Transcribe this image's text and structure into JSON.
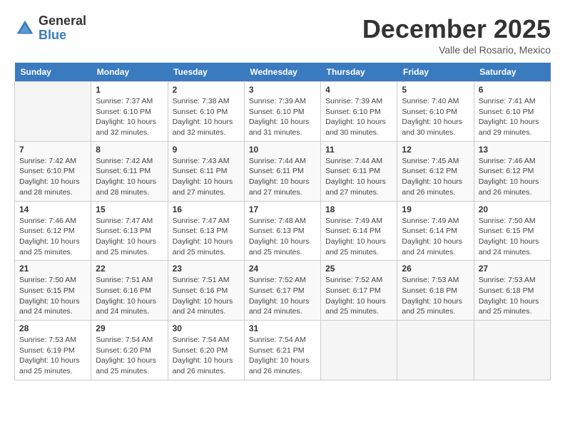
{
  "logo": {
    "general": "General",
    "blue": "Blue"
  },
  "title": "December 2025",
  "location": "Valle del Rosario, Mexico",
  "days_of_week": [
    "Sunday",
    "Monday",
    "Tuesday",
    "Wednesday",
    "Thursday",
    "Friday",
    "Saturday"
  ],
  "weeks": [
    [
      {
        "day": "",
        "info": ""
      },
      {
        "day": "1",
        "info": "Sunrise: 7:37 AM\nSunset: 6:10 PM\nDaylight: 10 hours\nand 32 minutes."
      },
      {
        "day": "2",
        "info": "Sunrise: 7:38 AM\nSunset: 6:10 PM\nDaylight: 10 hours\nand 32 minutes."
      },
      {
        "day": "3",
        "info": "Sunrise: 7:39 AM\nSunset: 6:10 PM\nDaylight: 10 hours\nand 31 minutes."
      },
      {
        "day": "4",
        "info": "Sunrise: 7:39 AM\nSunset: 6:10 PM\nDaylight: 10 hours\nand 30 minutes."
      },
      {
        "day": "5",
        "info": "Sunrise: 7:40 AM\nSunset: 6:10 PM\nDaylight: 10 hours\nand 30 minutes."
      },
      {
        "day": "6",
        "info": "Sunrise: 7:41 AM\nSunset: 6:10 PM\nDaylight: 10 hours\nand 29 minutes."
      }
    ],
    [
      {
        "day": "7",
        "info": "Sunrise: 7:42 AM\nSunset: 6:10 PM\nDaylight: 10 hours\nand 28 minutes."
      },
      {
        "day": "8",
        "info": "Sunrise: 7:42 AM\nSunset: 6:11 PM\nDaylight: 10 hours\nand 28 minutes."
      },
      {
        "day": "9",
        "info": "Sunrise: 7:43 AM\nSunset: 6:11 PM\nDaylight: 10 hours\nand 27 minutes."
      },
      {
        "day": "10",
        "info": "Sunrise: 7:44 AM\nSunset: 6:11 PM\nDaylight: 10 hours\nand 27 minutes."
      },
      {
        "day": "11",
        "info": "Sunrise: 7:44 AM\nSunset: 6:11 PM\nDaylight: 10 hours\nand 27 minutes."
      },
      {
        "day": "12",
        "info": "Sunrise: 7:45 AM\nSunset: 6:12 PM\nDaylight: 10 hours\nand 26 minutes."
      },
      {
        "day": "13",
        "info": "Sunrise: 7:46 AM\nSunset: 6:12 PM\nDaylight: 10 hours\nand 26 minutes."
      }
    ],
    [
      {
        "day": "14",
        "info": "Sunrise: 7:46 AM\nSunset: 6:12 PM\nDaylight: 10 hours\nand 25 minutes."
      },
      {
        "day": "15",
        "info": "Sunrise: 7:47 AM\nSunset: 6:13 PM\nDaylight: 10 hours\nand 25 minutes."
      },
      {
        "day": "16",
        "info": "Sunrise: 7:47 AM\nSunset: 6:13 PM\nDaylight: 10 hours\nand 25 minutes."
      },
      {
        "day": "17",
        "info": "Sunrise: 7:48 AM\nSunset: 6:13 PM\nDaylight: 10 hours\nand 25 minutes."
      },
      {
        "day": "18",
        "info": "Sunrise: 7:49 AM\nSunset: 6:14 PM\nDaylight: 10 hours\nand 25 minutes."
      },
      {
        "day": "19",
        "info": "Sunrise: 7:49 AM\nSunset: 6:14 PM\nDaylight: 10 hours\nand 24 minutes."
      },
      {
        "day": "20",
        "info": "Sunrise: 7:50 AM\nSunset: 6:15 PM\nDaylight: 10 hours\nand 24 minutes."
      }
    ],
    [
      {
        "day": "21",
        "info": "Sunrise: 7:50 AM\nSunset: 6:15 PM\nDaylight: 10 hours\nand 24 minutes."
      },
      {
        "day": "22",
        "info": "Sunrise: 7:51 AM\nSunset: 6:16 PM\nDaylight: 10 hours\nand 24 minutes."
      },
      {
        "day": "23",
        "info": "Sunrise: 7:51 AM\nSunset: 6:16 PM\nDaylight: 10 hours\nand 24 minutes."
      },
      {
        "day": "24",
        "info": "Sunrise: 7:52 AM\nSunset: 6:17 PM\nDaylight: 10 hours\nand 24 minutes."
      },
      {
        "day": "25",
        "info": "Sunrise: 7:52 AM\nSunset: 6:17 PM\nDaylight: 10 hours\nand 25 minutes."
      },
      {
        "day": "26",
        "info": "Sunrise: 7:53 AM\nSunset: 6:18 PM\nDaylight: 10 hours\nand 25 minutes."
      },
      {
        "day": "27",
        "info": "Sunrise: 7:53 AM\nSunset: 6:18 PM\nDaylight: 10 hours\nand 25 minutes."
      }
    ],
    [
      {
        "day": "28",
        "info": "Sunrise: 7:53 AM\nSunset: 6:19 PM\nDaylight: 10 hours\nand 25 minutes."
      },
      {
        "day": "29",
        "info": "Sunrise: 7:54 AM\nSunset: 6:20 PM\nDaylight: 10 hours\nand 25 minutes."
      },
      {
        "day": "30",
        "info": "Sunrise: 7:54 AM\nSunset: 6:20 PM\nDaylight: 10 hours\nand 26 minutes."
      },
      {
        "day": "31",
        "info": "Sunrise: 7:54 AM\nSunset: 6:21 PM\nDaylight: 10 hours\nand 26 minutes."
      },
      {
        "day": "",
        "info": ""
      },
      {
        "day": "",
        "info": ""
      },
      {
        "day": "",
        "info": ""
      }
    ]
  ]
}
